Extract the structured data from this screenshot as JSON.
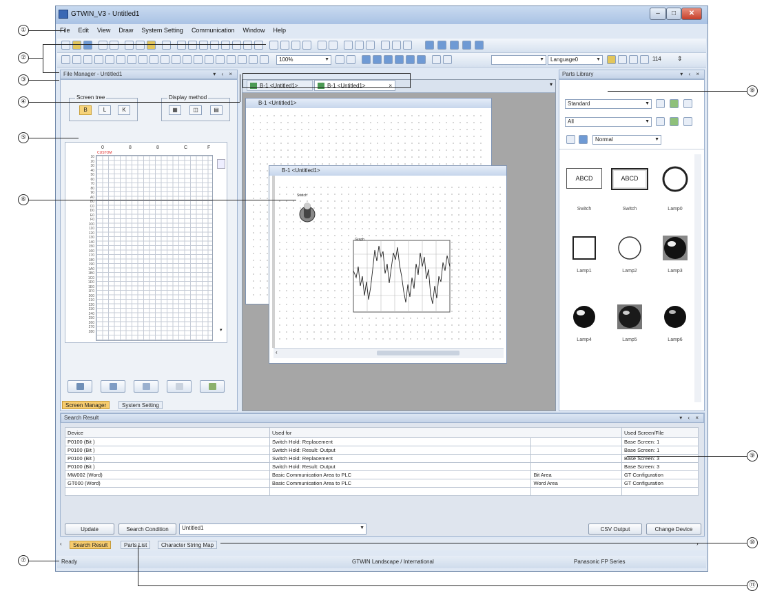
{
  "window": {
    "title": "GTWIN_V3 - Untitled1",
    "buttons": [
      "–",
      "□",
      "✕"
    ]
  },
  "menu": [
    "File",
    "Edit",
    "View",
    "Draw",
    "System Setting",
    "Communication",
    "Window",
    "Help"
  ],
  "toolbar2": {
    "zoom": "100%",
    "language": "Language0",
    "font_size": "114"
  },
  "file_manager": {
    "title": "File Manager - Untitled1",
    "controls": "▾ ‹ ×",
    "screen_tree_label": "Screen tree",
    "display_method_label": "Display method",
    "screen_tree_buttons": [
      "B",
      "L",
      "K"
    ],
    "display_buttons": [
      "▦",
      "◫",
      "▤"
    ],
    "col_headers": [
      "0",
      "8",
      "8",
      "C",
      "F"
    ],
    "red_label": "CUSTOM",
    "row_numbers": [
      "10",
      "20",
      "30",
      "40",
      "50",
      "60",
      "70",
      "80",
      "90",
      "A0",
      "B0",
      "C0",
      "D0",
      "E0",
      "F0",
      "100",
      "110",
      "120",
      "130",
      "140",
      "150",
      "160",
      "170",
      "180",
      "190",
      "1A0",
      "1B0",
      "1C0",
      "1D0",
      "1E0",
      "1F0",
      "200",
      "210",
      "220",
      "230",
      "240",
      "250",
      "260",
      "270",
      "280"
    ],
    "tabs": [
      "Screen Manager",
      "System Setting"
    ]
  },
  "doc_tabs": [
    {
      "label": "B-1 <Untitled1>"
    },
    {
      "label": "B-1 <Untitled1>"
    }
  ],
  "doc_windows": {
    "back_title": "B-1 <Untitled1>",
    "front_title": "B-1 <Untitled1>",
    "switch_label": "Switch",
    "graph_label": "Graph"
  },
  "parts_library": {
    "title": "Parts Library",
    "controls": "▾ ‹ ×",
    "category": "Standard",
    "filter": "All",
    "view": "Normal",
    "parts": [
      {
        "name": "Switch",
        "text": "ABCD"
      },
      {
        "name": "Switch",
        "text": "ABCD"
      },
      {
        "name": "Lamp0",
        "text": ""
      },
      {
        "name": "Lamp1",
        "text": ""
      },
      {
        "name": "Lamp2",
        "text": ""
      },
      {
        "name": "Lamp3",
        "text": ""
      },
      {
        "name": "Lamp4",
        "text": ""
      },
      {
        "name": "Lamp5",
        "text": ""
      },
      {
        "name": "Lamp6",
        "text": ""
      }
    ]
  },
  "search_result": {
    "title": "Search Result",
    "controls": "▾ ‹ ×",
    "headers": [
      "Device",
      "Used for",
      "Used Screen/File"
    ],
    "rows": [
      [
        "P0100 (Bit )",
        "Switch Hold: Replacement",
        "",
        "Base Screen: 1"
      ],
      [
        "P0100 (Bit )",
        "Switch Hold: Result: Output",
        "",
        "Base Screen: 1"
      ],
      [
        "P0100 (Bit )",
        "Switch Hold: Replacement",
        "",
        "Base Screen: 3"
      ],
      [
        "P0100 (Bit )",
        "Switch Hold: Result: Output",
        "",
        "Base Screen: 3"
      ],
      [
        "MW002 (Word)",
        "Basic Communication Area to PLC",
        "Bit Area",
        "GT Configuration"
      ],
      [
        "GT000 (Word)",
        "Basic Communication Area to PLC",
        "Word Area",
        "GT Configuration"
      ]
    ],
    "buttons": {
      "update": "Update",
      "search_condition": "Search Condition",
      "dropdown": "Untitled1",
      "csv_output": "CSV Output",
      "change_device": "Change Device"
    }
  },
  "bottom_tabs": [
    "Search Result",
    "Parts List",
    "Character String Map"
  ],
  "status": {
    "left": "Ready",
    "middle": "GTWIN Landscape / International",
    "right": "Panasonic FP Series"
  },
  "callouts": [
    "①",
    "②",
    "③",
    "④",
    "⑤",
    "⑥",
    "⑦",
    "⑧",
    "⑨",
    "⑩",
    "⑪"
  ]
}
